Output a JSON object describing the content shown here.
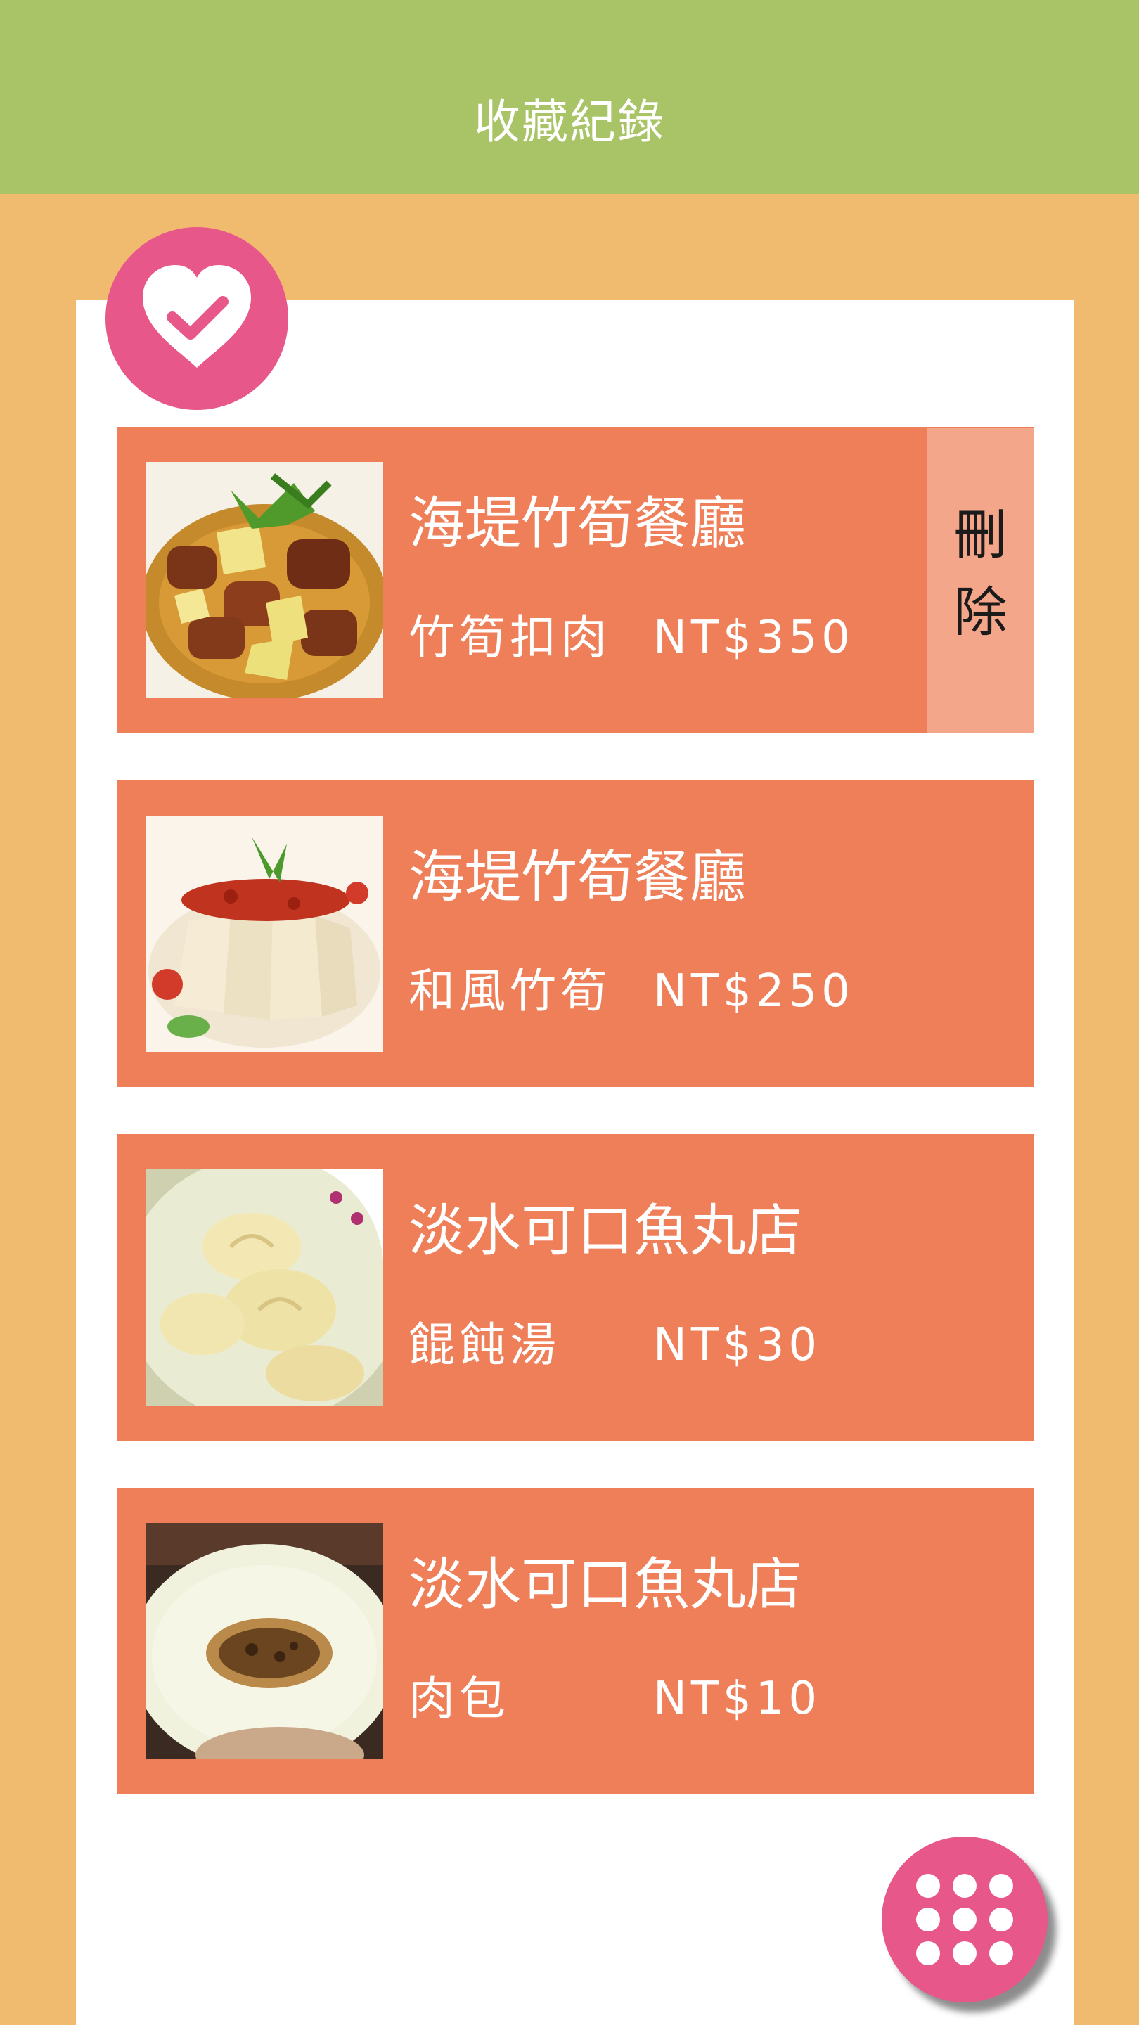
{
  "header": {
    "title": "收藏紀錄"
  },
  "badge": {
    "icon": "heart-check-icon"
  },
  "favorites": [
    {
      "shop": "海堤竹筍餐廳",
      "dish": "竹筍扣肉",
      "price": "NT$350",
      "thumb": "braised-pork-bamboo-photo"
    },
    {
      "shop": "海堤竹筍餐廳",
      "dish": "和風竹筍",
      "price": "NT$250",
      "thumb": "japanese-bamboo-shoot-photo"
    },
    {
      "shop": "淡水可口魚丸店",
      "dish": "餛飩湯",
      "price": "NT$30",
      "thumb": "wonton-soup-photo"
    },
    {
      "shop": "淡水可口魚丸店",
      "dish": "肉包",
      "price": "NT$10",
      "thumb": "meat-bun-photo"
    }
  ],
  "delete_action": {
    "line1": "刪",
    "line2": "除"
  },
  "fab": {
    "icon": "grid-menu-icon"
  },
  "colors": {
    "header": "#a8c466",
    "background": "#f0bb6f",
    "card": "#ef7f59",
    "delete": "#f3a68a",
    "accent": "#e8578a"
  }
}
